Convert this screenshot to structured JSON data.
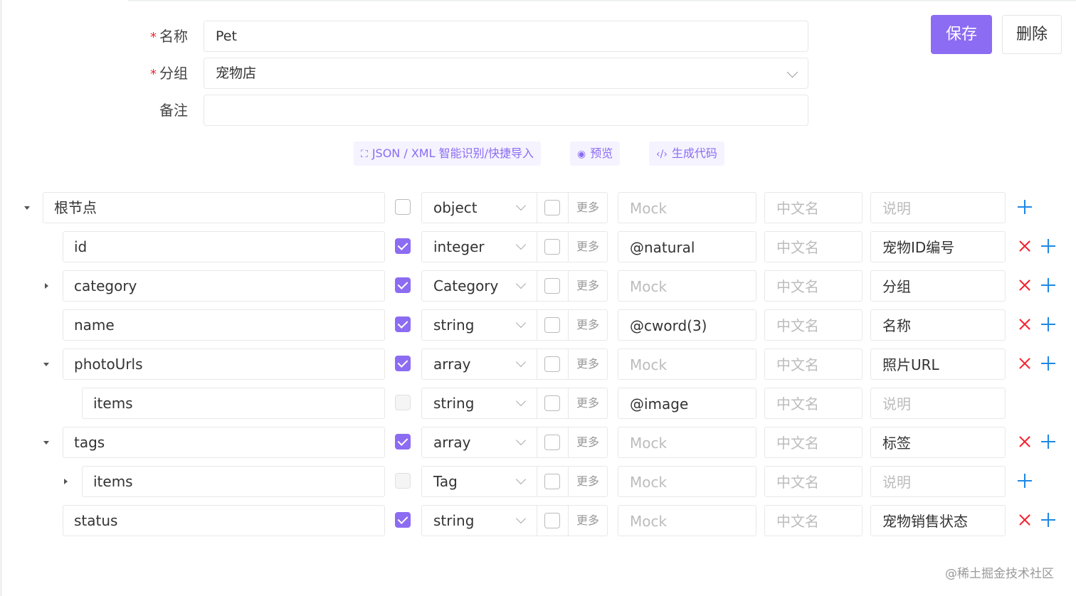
{
  "form": {
    "required_mark": "*",
    "name_label": "名称",
    "name_value": "Pet",
    "group_label": "分组",
    "group_value": "宠物店",
    "note_label": "备注",
    "note_value": ""
  },
  "actions": {
    "save_label": "保存",
    "delete_label": "删除"
  },
  "toolbar": {
    "import_label": "JSON / XML 智能识别/快捷导入",
    "preview_label": "预览",
    "codegen_label": "生成代码"
  },
  "schema": {
    "more_label": "更多",
    "rows": [
      {
        "name": "根节点",
        "required": false,
        "type": "object",
        "mock": "Mock",
        "mock_placeholder": true,
        "cn_name": "中文名",
        "description": "说明",
        "desc_placeholder": true
      },
      {
        "name": "id",
        "required": true,
        "type": "integer",
        "mock": "@natural",
        "mock_placeholder": false,
        "cn_name": "中文名",
        "description": "宠物ID编号",
        "desc_placeholder": false
      },
      {
        "name": "category",
        "required": true,
        "type": "Category",
        "mock": "Mock",
        "mock_placeholder": true,
        "cn_name": "中文名",
        "description": "分组",
        "desc_placeholder": false
      },
      {
        "name": "name",
        "required": true,
        "type": "string",
        "mock": "@cword(3)",
        "mock_placeholder": false,
        "cn_name": "中文名",
        "description": "名称",
        "desc_placeholder": false
      },
      {
        "name": "photoUrls",
        "required": true,
        "type": "array",
        "mock": "Mock",
        "mock_placeholder": true,
        "cn_name": "中文名",
        "description": "照片URL",
        "desc_placeholder": false
      },
      {
        "name": "items",
        "required": false,
        "type": "string",
        "mock": "@image",
        "mock_placeholder": false,
        "cn_name": "中文名",
        "description": "说明",
        "desc_placeholder": true
      },
      {
        "name": "tags",
        "required": true,
        "type": "array",
        "mock": "Mock",
        "mock_placeholder": true,
        "cn_name": "中文名",
        "description": "标签",
        "desc_placeholder": false
      },
      {
        "name": "items",
        "required": false,
        "type": "Tag",
        "mock": "Mock",
        "mock_placeholder": true,
        "cn_name": "中文名",
        "description": "说明",
        "desc_placeholder": true
      },
      {
        "name": "status",
        "required": true,
        "type": "string",
        "mock": "Mock",
        "mock_placeholder": true,
        "cn_name": "中文名",
        "description": "宠物销售状态",
        "desc_placeholder": false
      }
    ]
  },
  "watermark": "@稀土掘金技术社区",
  "colors": {
    "accent": "#8c6cf2",
    "delete": "#f5222d",
    "add": "#1e88e5"
  }
}
